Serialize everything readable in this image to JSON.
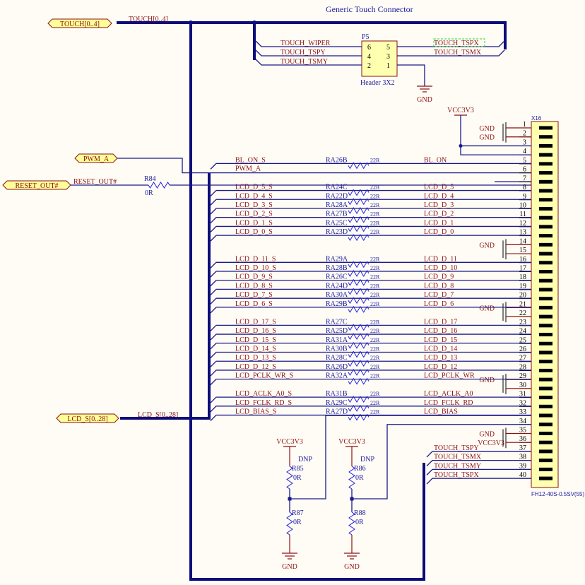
{
  "title": "Generic Touch Connector",
  "ports": {
    "touch": "TOUCH[0..4]",
    "pwm": "PWM_A",
    "reset": "RESET_OUT#",
    "lcd": "LCD_S[0..28]"
  },
  "bus_labels": {
    "touch": "TOUCH[0..4]",
    "lcd": "LCD_S[0..28]"
  },
  "reset_net": "RESET_OUT#",
  "r84": {
    "ref": "R84",
    "value": "0R"
  },
  "header": {
    "ref": "P5",
    "name": "Header 3X2",
    "pins": [
      "6",
      "5",
      "4",
      "3",
      "2",
      "1"
    ],
    "left_nets": [
      "TOUCH_WIPER",
      "TOUCH_TSPY",
      "TOUCH_TSMY"
    ],
    "right_nets": [
      "TOUCH_TSPX",
      "TOUCH_TSMX"
    ],
    "gnd": "GND"
  },
  "connector": {
    "ref": "X16",
    "part": "FH12-40S-0.5SV(55)",
    "vcc": "VCC3V3",
    "gnd": "GND",
    "pin_count": 40,
    "gnd_pins": [
      1,
      2,
      14,
      15,
      21,
      22,
      29,
      30,
      35
    ],
    "vcc_pin36": "VCC3V3",
    "touch_nets": [
      {
        "pin": 37,
        "net": "TOUCH_TSPY"
      },
      {
        "pin": 38,
        "net": "TOUCH_TSMX"
      },
      {
        "pin": 39,
        "net": "TOUCH_TSMY"
      },
      {
        "pin": 40,
        "net": "TOUCH_TSPX"
      }
    ]
  },
  "pwm_net": "PWM_A",
  "signals": [
    {
      "pin": 5,
      "left": "BL_ON_S",
      "ra": "RA26B",
      "val": "22R",
      "right": "BL_ON"
    },
    {
      "pin": 8,
      "left": "LCD_D_5_S",
      "ra": "RA24C",
      "val": "22R",
      "right": "LCD_D_5"
    },
    {
      "pin": 9,
      "left": "LCD_D_4_S",
      "ra": "RA22D",
      "val": "22R",
      "right": "LCD_D_4"
    },
    {
      "pin": 10,
      "left": "LCD_D_3_S",
      "ra": "RA28A",
      "val": "22R",
      "right": "LCD_D_3"
    },
    {
      "pin": 11,
      "left": "LCD_D_2_S",
      "ra": "RA27B",
      "val": "22R",
      "right": "LCD_D_2"
    },
    {
      "pin": 12,
      "left": "LCD_D_1_S",
      "ra": "RA25C",
      "val": "22R",
      "right": "LCD_D_1"
    },
    {
      "pin": 13,
      "left": "LCD_D_0_S",
      "ra": "RA23D",
      "val": "22R",
      "right": "LCD_D_0"
    },
    {
      "pin": 16,
      "left": "LCD_D_11_S",
      "ra": "RA29A",
      "val": "22R",
      "right": "LCD_D_11"
    },
    {
      "pin": 17,
      "left": "LCD_D_10_S",
      "ra": "RA28B",
      "val": "22R",
      "right": "LCD_D_10"
    },
    {
      "pin": 18,
      "left": "LCD_D_9_S",
      "ra": "RA26C",
      "val": "22R",
      "right": "LCD_D_9"
    },
    {
      "pin": 19,
      "left": "LCD_D_8_S",
      "ra": "RA24D",
      "val": "22R",
      "right": "LCD_D_8"
    },
    {
      "pin": 20,
      "left": "LCD_D_7_S",
      "ra": "RA30A",
      "val": "22R",
      "right": "LCD_D_7"
    },
    {
      "pin": 21,
      "left": "LCD_D_6_S",
      "ra": "RA29B",
      "val": "22R",
      "right": "LCD_D_6"
    },
    {
      "pin": 23,
      "left": "LCD_D_17_S",
      "ra": "RA27C",
      "val": "22R",
      "right": "LCD_D_17"
    },
    {
      "pin": 24,
      "left": "LCD_D_16_S",
      "ra": "RA25D",
      "val": "22R",
      "right": "LCD_D_16"
    },
    {
      "pin": 25,
      "left": "LCD_D_15_S",
      "ra": "RA31A",
      "val": "22R",
      "right": "LCD_D_15"
    },
    {
      "pin": 26,
      "left": "LCD_D_14_S",
      "ra": "RA30B",
      "val": "22R",
      "right": "LCD_D_14"
    },
    {
      "pin": 27,
      "left": "LCD_D_13_S",
      "ra": "RA28C",
      "val": "22R",
      "right": "LCD_D_13"
    },
    {
      "pin": 28,
      "left": "LCD_D_12_S",
      "ra": "RA26D",
      "val": "22R",
      "right": "LCD_D_12"
    },
    {
      "pin": 29,
      "left": "LCD_PCLK_WR_S",
      "ra": "RA32A",
      "val": "22R",
      "right": "LCD_PCLK_WR"
    },
    {
      "pin": 31,
      "left": "LCD_ACLK_A0_S",
      "ra": "RA31B",
      "val": "22R",
      "right": "LCD_ACLK_A0"
    },
    {
      "pin": 32,
      "left": "LCD_FCLK_RD_S",
      "ra": "RA29C",
      "val": "22R",
      "right": "LCD_FCLK_RD"
    },
    {
      "pin": 33,
      "left": "LCD_BIAS_S",
      "ra": "RA27D",
      "val": "22R",
      "right": "LCD_BIAS"
    }
  ],
  "dividers": [
    {
      "top": "R85",
      "bottom": "R87",
      "value": "0R",
      "note": "DNP",
      "vcc": "VCC3V3",
      "gnd": "GND"
    },
    {
      "top": "R86",
      "bottom": "R88",
      "value": "0R",
      "note": "DNP",
      "vcc": "VCC3V3",
      "gnd": "GND"
    }
  ],
  "colors": {
    "wire": "#1a1a8c",
    "net_label": "#8b1010",
    "component": "#ffffb0",
    "background": "#fffcf5"
  }
}
